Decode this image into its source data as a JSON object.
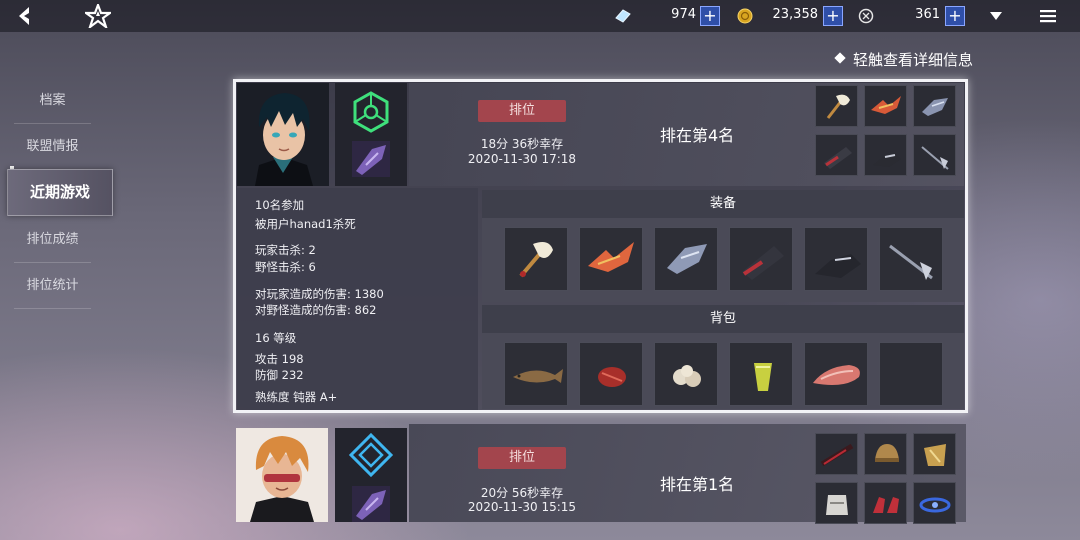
{
  "topbar": {
    "crystals": "974",
    "gold": "23,358",
    "tokens": "361",
    "plus": "+"
  },
  "hint": "轻触查看详细信息",
  "nav": {
    "items": [
      "档案",
      "联盟情报",
      "近期游戏",
      "排位成绩",
      "排位统计"
    ],
    "active": "近期游戏"
  },
  "games": [
    {
      "mode": "排位",
      "survival": "18分 36秒幸存",
      "datetime": "2020-11-30 17:18",
      "place": "排在第4名",
      "details": {
        "participants": "10名参加",
        "killed_by": "被用户hanad1杀死",
        "player_kills": "玩家击杀: 2",
        "monster_kills": "野怪击杀: 6",
        "player_damage": "对玩家造成的伤害: 1380",
        "monster_damage": "对野怪造成的伤害: 862",
        "level": "16 等级",
        "attack": "攻击 198",
        "defense": "防御 232",
        "mastery": "熟练度  钝器 A+"
      },
      "equipment_label": "装备",
      "bag_label": "背包"
    },
    {
      "mode": "排位",
      "survival": "20分 56秒幸存",
      "datetime": "2020-11-30 15:15",
      "place": "排在第1名"
    }
  ]
}
